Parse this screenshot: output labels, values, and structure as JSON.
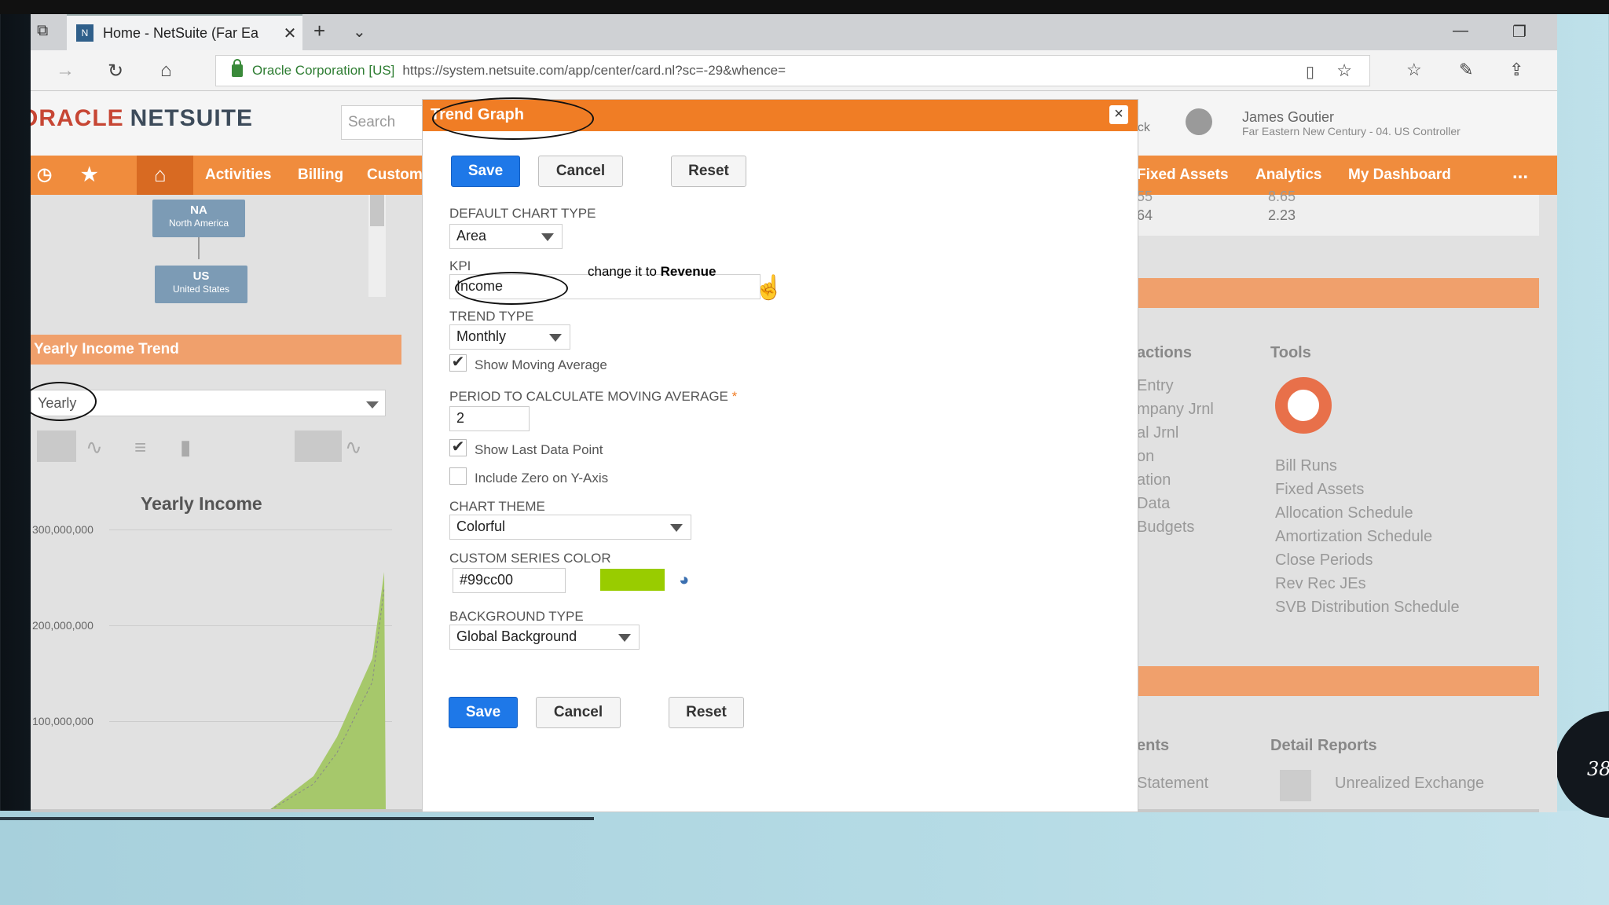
{
  "browser": {
    "tab_title": "Home - NetSuite (Far Ea",
    "tab_favicon": "N",
    "org": "Oracle Corporation [US]",
    "url": "https://system.netsuite.com/app/center/card.nl?sc=-29&whence="
  },
  "header": {
    "logo_oracle": "ORACLE",
    "logo_netsuite": "NETSUITE",
    "search_placeholder": "Search",
    "back_text": "ack",
    "user_name": "James Goutier",
    "user_role": "Far Eastern New Century - 04. US Controller"
  },
  "nav": {
    "items": [
      "Activities",
      "Billing",
      "Customers"
    ],
    "right_items": [
      "Fixed Assets",
      "Analytics",
      "My Dashboard"
    ],
    "more": "..."
  },
  "left": {
    "node_na_code": "NA",
    "node_na_name": "North America",
    "node_us_code": "US",
    "node_us_name": "United States",
    "panel_title": "Yearly Income Trend",
    "period_value": "Yearly",
    "chart_title": "Yearly Income",
    "y_ticks": [
      "300,000,000",
      "200,000,000",
      "100,000,000"
    ]
  },
  "chart_data": {
    "type": "area",
    "title": "Yearly Income",
    "yticks": [
      100000000,
      200000000,
      300000000
    ]
  },
  "right": {
    "row1_a": "64",
    "row1_b": "2.23",
    "row0_a": "55",
    "row0_b": "8.65",
    "transactions_header": "actions",
    "transactions": [
      "Entry",
      "mpany Jrnl",
      "al Jrnl",
      "on",
      "ation",
      "Data",
      "Budgets"
    ],
    "tools_header": "Tools",
    "tools": [
      "Bill Runs",
      "Fixed Assets",
      "Allocation Schedule",
      "Amortization Schedule",
      "Close Periods",
      "Rev Rec JEs",
      "SVB Distribution Schedule"
    ],
    "statements_header": "ents",
    "statements_item": "Statement",
    "detail_header": "Detail Reports",
    "detail_item": "Unrealized Exchange"
  },
  "modal": {
    "title": "Trend Graph",
    "save": "Save",
    "cancel": "Cancel",
    "reset": "Reset",
    "default_chart_type_label": "Default Chart Type",
    "default_chart_type_value": "Area",
    "kpi_label": "KPI",
    "kpi_value": "Income",
    "annotation_prefix": "change it to ",
    "annotation_bold": "Revenue",
    "trend_type_label": "Trend Type",
    "trend_type_value": "Monthly",
    "show_moving_average": "Show Moving Average",
    "period_label": "Period to Calculate Moving Average",
    "required_mark": "*",
    "period_value": "2",
    "show_last_data_point": "Show Last Data Point",
    "include_zero": "Include Zero on Y-Axis",
    "chart_theme_label": "Chart Theme",
    "chart_theme_value": "Colorful",
    "custom_series_color_label": "Custom Series Color",
    "custom_series_color_value": "#99cc00",
    "background_type_label": "Background Type",
    "background_type_value": "Global Background",
    "checkmark": "✔"
  },
  "slide": {
    "page_number": "38"
  },
  "colors": {
    "accent_orange": "#f07d25",
    "primary_blue": "#1e78e8",
    "series_color": "#99cc00"
  }
}
